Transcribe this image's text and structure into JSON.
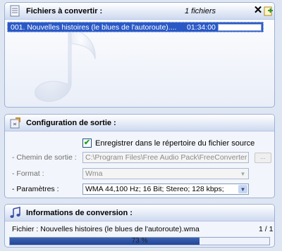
{
  "files_panel": {
    "title": "Fichiers à convertir :",
    "count": "1 fichiers",
    "close_icon": "close-icon",
    "add_icon": "add-file-icon",
    "items": [
      {
        "name": "001. Nouvelles histoires (le blues de l'autoroute)....",
        "duration": "01:34:00",
        "progress": 0
      }
    ]
  },
  "config_panel": {
    "title": "Configuration de sortie :",
    "save_in_source": {
      "label": "Enregistrer dans le répertoire du fichier source",
      "checked": true
    },
    "output_path": {
      "label": "- Chemin de sortie :",
      "value": "C:\\Program Files\\Free Audio Pack\\FreeConverter",
      "browse_label": "..."
    },
    "format": {
      "label": "- Format :",
      "value": "Wma"
    },
    "params": {
      "label": "- Paramètres :",
      "value": "WMA 44,100 Hz; 16 Bit; Stereo; 128 kbps;"
    }
  },
  "info_panel": {
    "title": "Informations de conversion :",
    "file_text": "Fichier : Nouvelles histoires (le blues de l'autoroute).wma",
    "count": "1 / 1",
    "progress_percent": 73,
    "progress_text": "73 %"
  },
  "colors": {
    "selection": "#2a59c6",
    "progress": "#2f55a8",
    "panel_border": "#9bb0d4"
  }
}
